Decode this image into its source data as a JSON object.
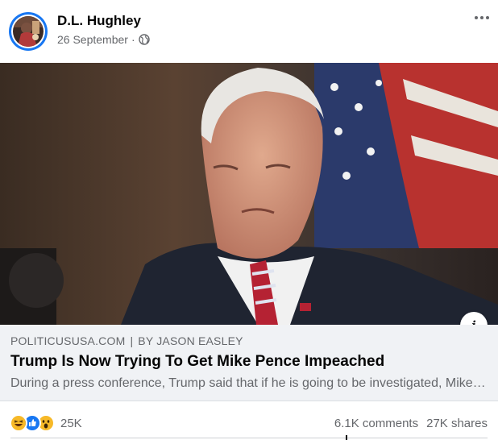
{
  "post": {
    "author": "D.L. Hughley",
    "date": "26 September",
    "separator": "·",
    "privacy_icon": "globe-icon",
    "more_icon": "more-options-icon"
  },
  "link_preview": {
    "source": "POLITICUSUSA.COM",
    "divider": "|",
    "byline": "BY JASON EASLEY",
    "title": "Trump Is Now Trying To Get Mike Pence Impeached",
    "description": "During a press conference, Trump said that if he is going to be investigated, Mike Pence should be investigated too.",
    "info_icon": "i"
  },
  "footer": {
    "reaction_icons": [
      "haha-icon",
      "like-icon",
      "wow-icon"
    ],
    "reaction_count": "25K",
    "comments": "6.1K comments",
    "shares": "27K shares"
  },
  "colors": {
    "facebook_blue": "#1877f2",
    "secondary_text": "#65676b",
    "link_box_bg": "#f0f2f5",
    "haha_yellow": "#f7b928",
    "like_blue": "#1877f2"
  }
}
